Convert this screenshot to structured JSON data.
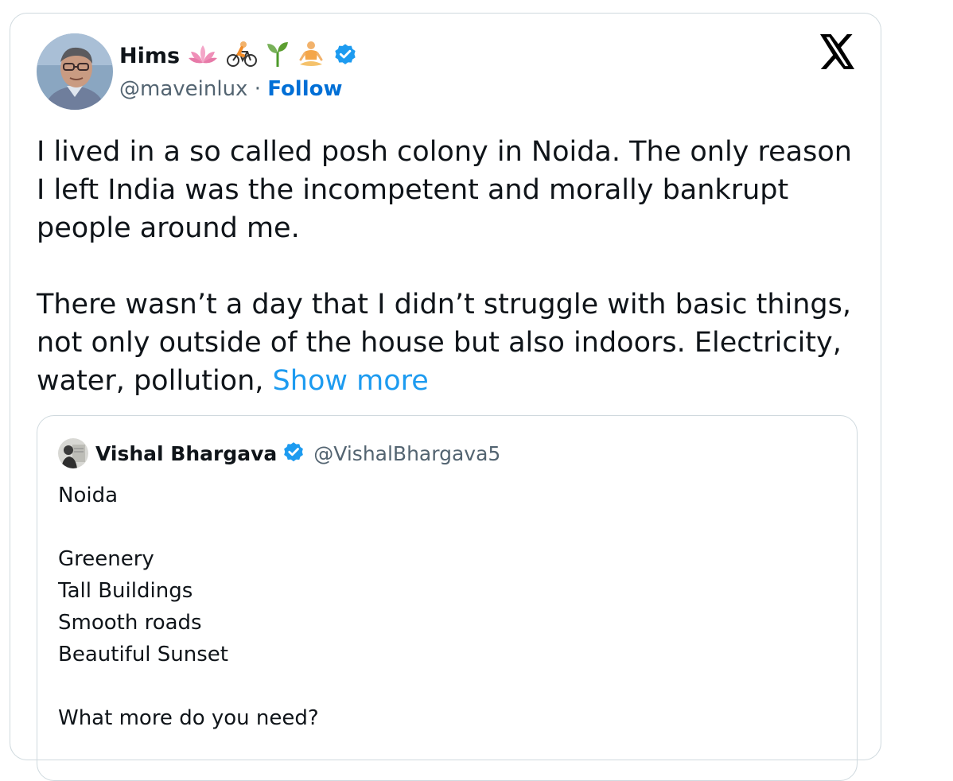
{
  "tweet": {
    "author_name": "Hims",
    "author_emojis": [
      "lotus-emoji",
      "cyclist-emoji",
      "seedling-emoji",
      "meditation-emoji"
    ],
    "handle": "@maveinlux",
    "separator": "·",
    "follow_label": "Follow",
    "paragraphs": [
      "I lived in a so called posh colony in Noida. The only reason I left India was the incompetent and morally bankrupt people around me.",
      "There wasn’t a day that I didn’t struggle with basic things, not only outside of the house but also indoors. Electricity, water, pollution,"
    ],
    "show_more_label": "Show more"
  },
  "quote": {
    "author_name": "Vishal Bhargava",
    "handle": "@VishalBhargava5",
    "lines": [
      "Noida",
      "",
      "Greenery",
      "Tall Buildings",
      "Smooth roads",
      "Beautiful Sunset",
      "",
      "What more do you need?"
    ]
  },
  "colors": {
    "text": "#0f1419",
    "secondary": "#536471",
    "follow": "#006fd6",
    "link": "#1d9bf0",
    "verified": "#1d9bf0",
    "border": "#cfd9de"
  },
  "icons": {
    "brand": "x-logo-icon",
    "verified": "verified-badge-icon"
  }
}
